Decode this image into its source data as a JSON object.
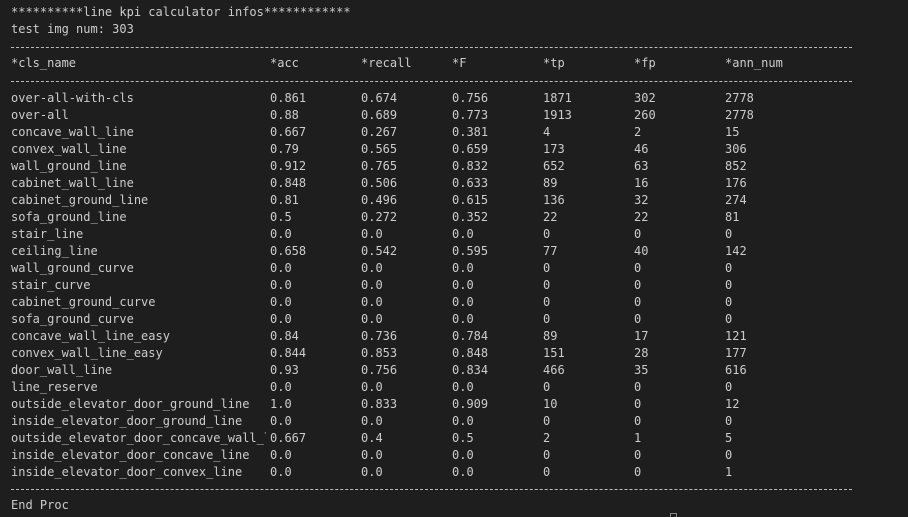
{
  "terminal": {
    "title_line": "**********line kpi calculator infos************",
    "img_num_line": "test img num: 303",
    "footer": "End Proc"
  },
  "table": {
    "headers": [
      "*cls_name",
      "*acc",
      "*recall",
      "*F",
      "*tp",
      "*fp",
      "*ann_num"
    ],
    "rows": [
      [
        "over-all-with-cls",
        "0.861",
        "0.674",
        "0.756",
        "1871",
        "302",
        "2778"
      ],
      [
        "over-all",
        "0.88",
        "0.689",
        "0.773",
        "1913",
        "260",
        "2778"
      ],
      [
        "concave_wall_line",
        "0.667",
        "0.267",
        "0.381",
        "4",
        "2",
        "15"
      ],
      [
        "convex_wall_line",
        "0.79",
        "0.565",
        "0.659",
        "173",
        "46",
        "306"
      ],
      [
        "wall_ground_line",
        "0.912",
        "0.765",
        "0.832",
        "652",
        "63",
        "852"
      ],
      [
        "cabinet_wall_line",
        "0.848",
        "0.506",
        "0.633",
        "89",
        "16",
        "176"
      ],
      [
        "cabinet_ground_line",
        "0.81",
        "0.496",
        "0.615",
        "136",
        "32",
        "274"
      ],
      [
        "sofa_ground_line",
        "0.5",
        "0.272",
        "0.352",
        "22",
        "22",
        "81"
      ],
      [
        "stair_line",
        "0.0",
        "0.0",
        "0.0",
        "0",
        "0",
        "0"
      ],
      [
        "ceiling_line",
        "0.658",
        "0.542",
        "0.595",
        "77",
        "40",
        "142"
      ],
      [
        "wall_ground_curve",
        "0.0",
        "0.0",
        "0.0",
        "0",
        "0",
        "0"
      ],
      [
        "stair_curve",
        "0.0",
        "0.0",
        "0.0",
        "0",
        "0",
        "0"
      ],
      [
        "cabinet_ground_curve",
        "0.0",
        "0.0",
        "0.0",
        "0",
        "0",
        "0"
      ],
      [
        "sofa_ground_curve",
        "0.0",
        "0.0",
        "0.0",
        "0",
        "0",
        "0"
      ],
      [
        "concave_wall_line_easy",
        "0.84",
        "0.736",
        "0.784",
        "89",
        "17",
        "121"
      ],
      [
        "convex_wall_line_easy",
        "0.844",
        "0.853",
        "0.848",
        "151",
        "28",
        "177"
      ],
      [
        "door_wall_line",
        "0.93",
        "0.756",
        "0.834",
        "466",
        "35",
        "616"
      ],
      [
        "line_reserve",
        "0.0",
        "0.0",
        "0.0",
        "0",
        "0",
        "0"
      ],
      [
        "outside_elevator_door_ground_line",
        "1.0",
        "0.833",
        "0.909",
        "10",
        "0",
        "12"
      ],
      [
        "inside_elevator_door_ground_line",
        "0.0",
        "0.0",
        "0.0",
        "0",
        "0",
        "0"
      ],
      [
        "outside_elevator_door_concave_wall_l",
        "0.667",
        "0.4",
        "0.5",
        "2",
        "1",
        "5"
      ],
      [
        "inside_elevator_door_concave_line",
        "0.0",
        "0.0",
        "0.0",
        "0",
        "0",
        "0"
      ],
      [
        "inside_elevator_door_convex_line",
        "0.0",
        "0.0",
        "0.0",
        "0",
        "0",
        "1"
      ]
    ]
  },
  "colors": {
    "background": "#1e1e1e",
    "text": "#cccccc",
    "separator": "#bbbbbb"
  }
}
